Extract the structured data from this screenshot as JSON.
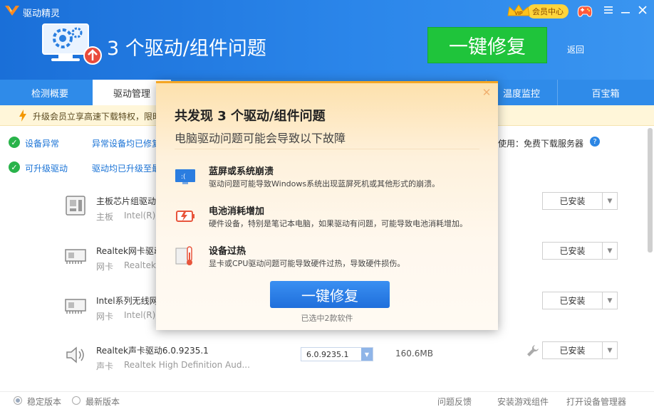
{
  "app": {
    "title": "驱动精灵"
  },
  "header": {
    "hero_title": "3 个驱动/组件问题",
    "fix_button": "一键修复",
    "back": "返回",
    "vip_badge": "VIP",
    "vip_label": "会员中心"
  },
  "tabs": [
    {
      "label": "检测概要"
    },
    {
      "label": "驱动管理"
    },
    {
      "label": "温度监控"
    },
    {
      "label": "百宝箱"
    }
  ],
  "notice": {
    "text": "升级会员立享高速下载特权，限时"
  },
  "status": {
    "device_label": "设备异常",
    "device_link": "异常设备均已修复",
    "upgrade_label": "可升级驱动",
    "upgrade_link": "驱动均已升级至最",
    "right_text": "使用：免费下载服务器"
  },
  "drivers": [
    {
      "name": "主板芯片组驱动",
      "type": "主板",
      "vendor": "Intel(R)",
      "action": "已安装"
    },
    {
      "name": "Realtek网卡驱动",
      "type": "网卡",
      "vendor": "Realtek",
      "action": "已安装"
    },
    {
      "name": "Intel系列无线网",
      "type": "网卡",
      "vendor": "Intel(R)",
      "action": "已安装"
    },
    {
      "name": "Realtek声卡驱动6.0.9235.1",
      "type": "声卡",
      "vendor": "Realtek High Definition Aud...",
      "version": "6.0.9235.1",
      "size": "160.6MB",
      "action": "已安装"
    }
  ],
  "footer": {
    "stable": "稳定版本",
    "latest": "最新版本",
    "feedback": "问题反馈",
    "install_game": "安装游戏组件",
    "device_manager": "打开设备管理器"
  },
  "modal": {
    "title": "共发现 3 个驱动/组件问题",
    "subtitle": "电脑驱动问题可能会导致以下故障",
    "issues": [
      {
        "title": "蓝屏或系统崩溃",
        "desc": "驱动问题可能导致Windows系统出现蓝屏死机或其他形式的崩溃。"
      },
      {
        "title": "电池消耗增加",
        "desc": "硬件设备，特别是笔记本电脑，如果驱动有问题，可能导致电池消耗增加。"
      },
      {
        "title": "设备过热",
        "desc": "显卡或CPU驱动问题可能导致硬件过热，导致硬件损伤。"
      }
    ],
    "button": "一键修复",
    "note": "已选中2款软件",
    "bsod_text": ":("
  },
  "colors": {
    "header": "#1a6fd8",
    "fix_green": "#1fc43b",
    "modal_button": "#1f6fdb",
    "check_green": "#29b34a"
  }
}
